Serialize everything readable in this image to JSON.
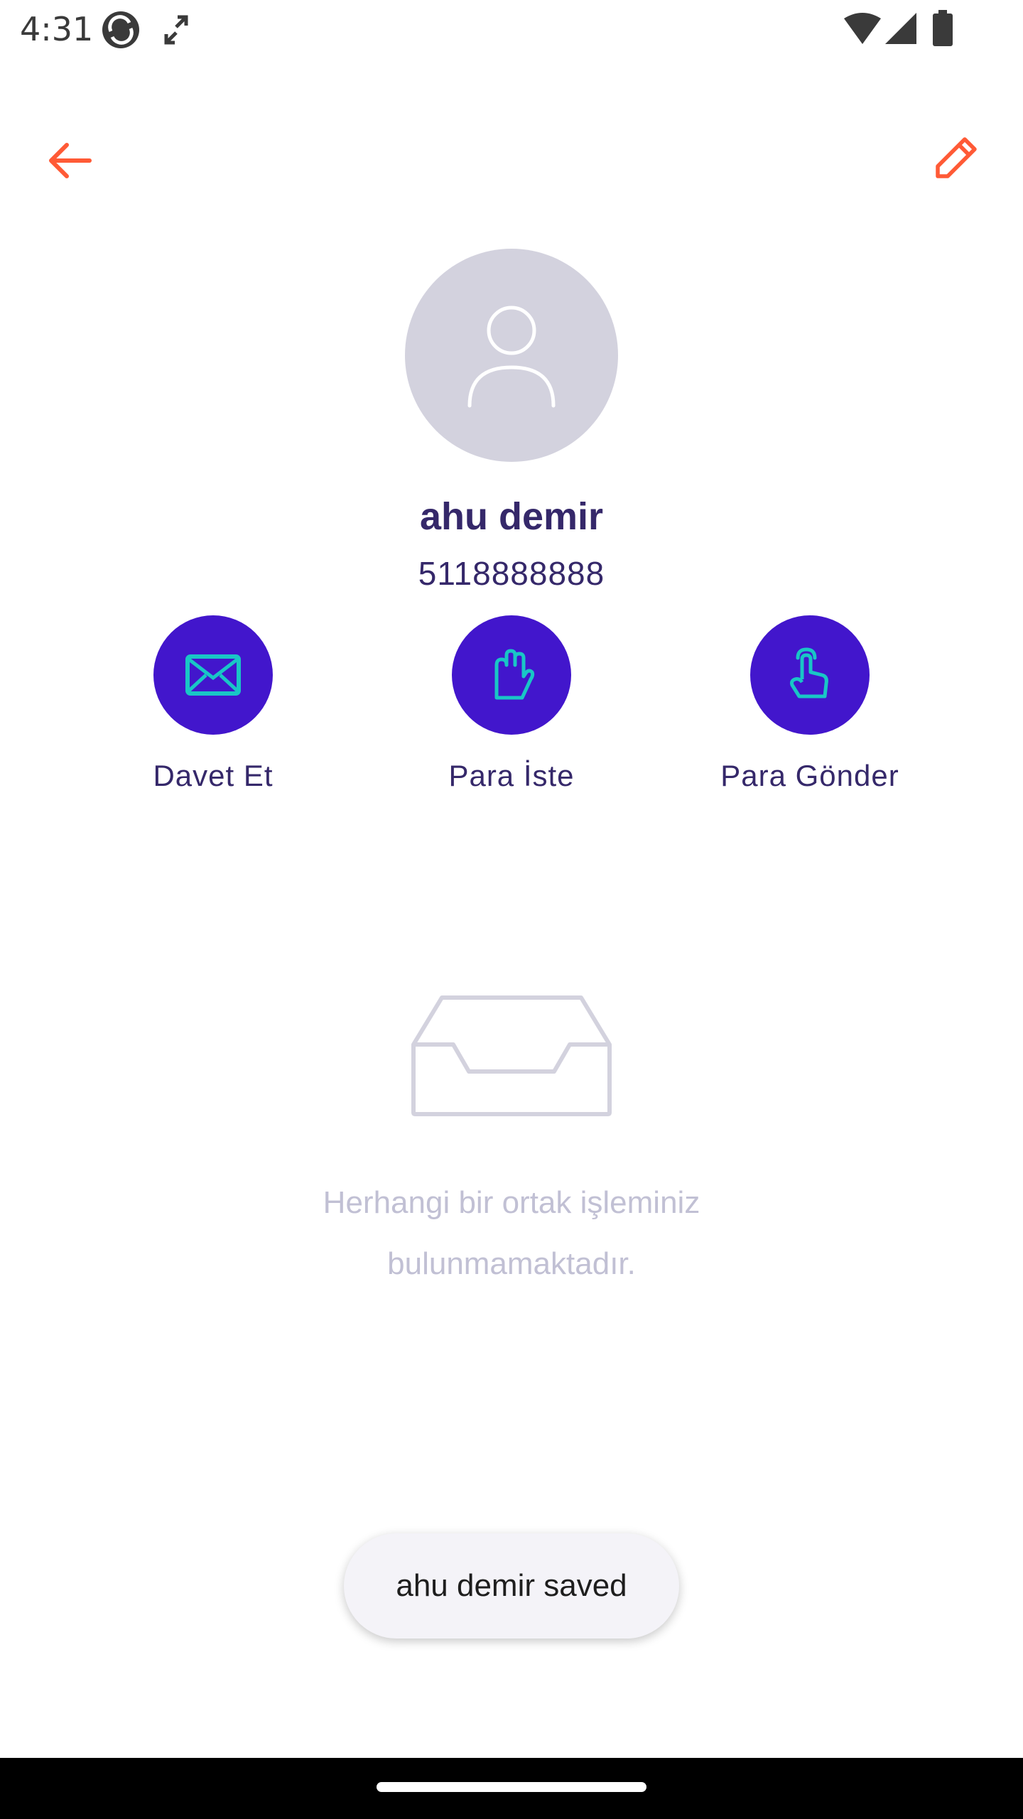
{
  "status_bar": {
    "time": "4:31"
  },
  "header": {
    "back_icon": "arrow-left-icon",
    "edit_icon": "pencil-icon"
  },
  "contact": {
    "avatar_icon": "user-icon",
    "name": "ahu demir",
    "phone": "5118888888"
  },
  "actions": [
    {
      "label": "Davet Et",
      "icon": "envelope-icon"
    },
    {
      "label": "Para İste",
      "icon": "hand-stop-icon"
    },
    {
      "label": "Para Gönder",
      "icon": "hand-pointer-icon"
    }
  ],
  "empty_state": {
    "icon": "inbox-tray-icon",
    "line1": "Herhangi bir ortak işleminiz",
    "line2": "bulunmamaktadır."
  },
  "toast": {
    "message": "ahu demir saved"
  },
  "colors": {
    "accent_orange": "#ff5a36",
    "action_purple": "#4216cc",
    "icon_teal": "#19c6c6",
    "text_dark_purple": "#35286a",
    "avatar_bg": "#d3d2de",
    "muted_text": "#c1c0d4"
  }
}
